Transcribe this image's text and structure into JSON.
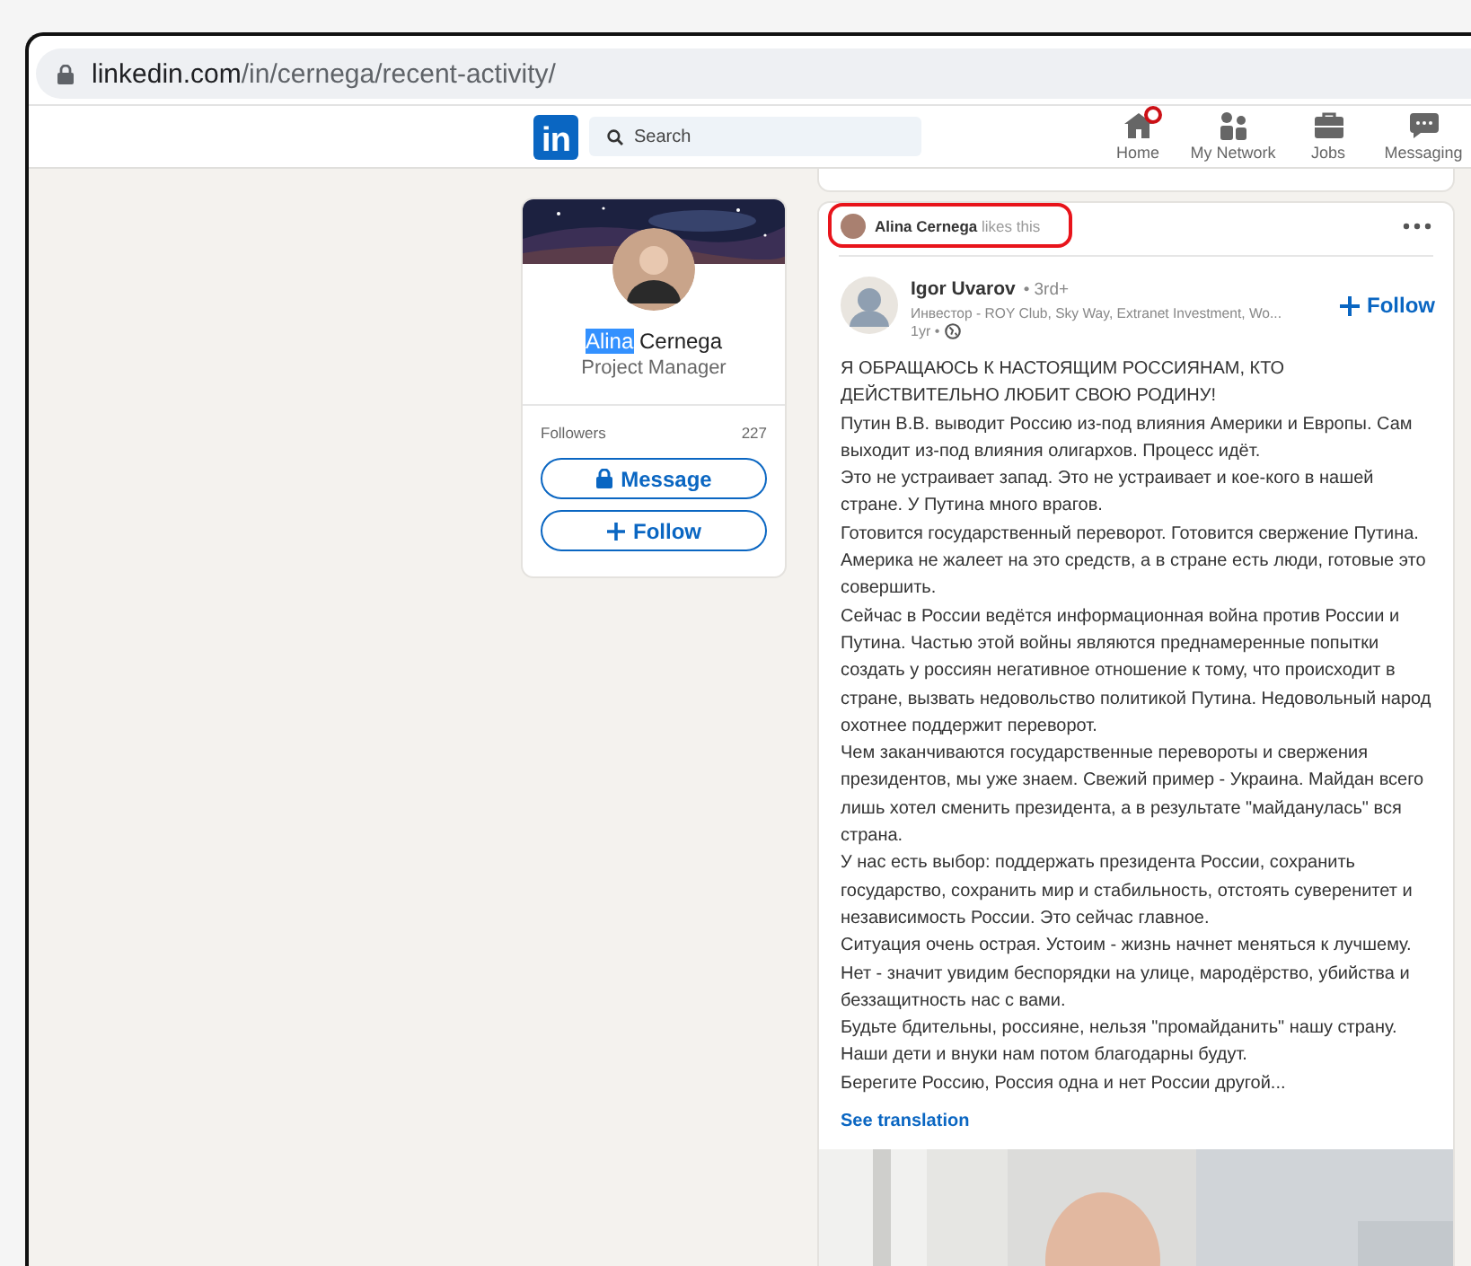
{
  "browser": {
    "url_host": "linkedin.com",
    "url_path": "/in/cernega/recent-activity/"
  },
  "nav": {
    "logo": "in",
    "search_placeholder": "Search",
    "items": [
      {
        "label": "Home",
        "kind": "home",
        "notification": true
      },
      {
        "label": "My Network",
        "kind": "network",
        "notification": false
      },
      {
        "label": "Jobs",
        "kind": "jobs",
        "notification": false
      },
      {
        "label": "Messaging",
        "kind": "messaging",
        "notification": false
      }
    ]
  },
  "profile": {
    "first_name": "Alina",
    "last_name": "Cernega",
    "first_name_highlighted": true,
    "headline": "Project Manager",
    "stats": [
      {
        "label": "Followers",
        "value": "227"
      }
    ],
    "buttons": [
      {
        "label": "Message",
        "kind": "message"
      },
      {
        "label": "Follow",
        "kind": "follow"
      }
    ]
  },
  "post": {
    "activity": {
      "actor": "Alina Cernega",
      "action": "likes this",
      "annotated": true
    },
    "author": {
      "name": "Igor Uvarov",
      "degree": "• 3rd+",
      "headline": "Инвестор - ROY Club, Sky Way, Extranet Investment, Wo...",
      "time": "1yr •"
    },
    "follow_label": "Follow",
    "paragraphs": [
      "Я ОБРАЩАЮСЬ К НАСТОЯЩИМ РОССИЯНАМ, КТО ДЕЙСТВИТЕЛЬНО ЛЮБИТ СВОЮ РОДИНУ!",
      "Путин В.В. выводит Россию из-под влияния Америки и Европы. Сам выходит из-под влияния олигархов. Процесс идёт.",
      "Это не устраивает запад. Это не устраивает и кое-кого в нашей стране. У Путина много врагов.",
      "Готовится государственный переворот. Готовится свержение Путина. Америка не жалеет на это средств, а в стране есть люди, готовые это совершить.",
      "Сейчас в России ведётся информационная война против России и Путина. Частью этой войны являются преднамеренные попытки создать у россиян негативное отношение к тому, что происходит в стране, вызвать недовольство политикой Путина. Недовольный народ охотнее поддержит переворот.",
      "Чем заканчиваются государственные перевороты и свержения президентов, мы уже знаем. Свежий пример - Украина. Майдан всего лишь хотел сменить президента, а в результате \"майданулась\" вся страна.",
      "У нас есть выбор: поддержать президента России, сохранить государство, сохранить мир и стабильность, отстоять суверенитет и независимость России. Это сейчас главное.",
      "Ситуация очень острая. Устоим - жизнь начнет меняться к лучшему. Нет - значит увидим беспорядки на улице, мародёрство, убийства и беззащитность нас с вами.",
      "Будьте бдительны, россияне, нельзя \"промайданить\" нашу страну.",
      "Наши дети и внуки нам потом благодарны будут.",
      "Берегите Россию, Россия одна и нет России другой..."
    ],
    "see_translation": "See translation"
  }
}
